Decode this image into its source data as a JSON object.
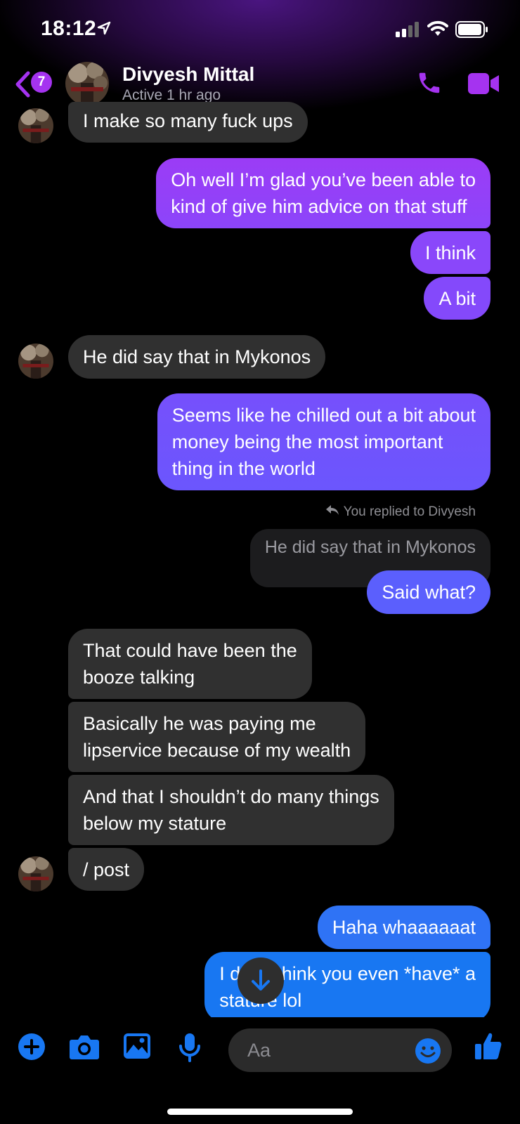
{
  "status_bar": {
    "time": "18:12",
    "location_icon": "location-arrow-icon",
    "signal_icon": "cellular-signal-icon",
    "wifi_icon": "wifi-icon",
    "battery_icon": "battery-icon"
  },
  "header": {
    "back_icon": "chevron-left-icon",
    "unread_count": "7",
    "contact_name": "Divyesh Mittal",
    "contact_status": "Active 1 hr ago",
    "call_icon": "phone-icon",
    "video_icon": "video-camera-icon"
  },
  "colors": {
    "accent": "#a533f0",
    "incoming_bubble": "#303030",
    "blue": "#1877f2"
  },
  "messages": [
    {
      "from": "them",
      "text": "I make so many fuck ups"
    },
    {
      "from": "me",
      "lines": [
        "Oh well I’m glad you’ve been able to",
        "kind of give him advice on that stuff"
      ]
    },
    {
      "from": "me",
      "text": "I think"
    },
    {
      "from": "me",
      "text": "A bit"
    },
    {
      "from": "them",
      "text": "He did say that in Mykonos"
    },
    {
      "from": "me",
      "lines": [
        "Seems like he chilled out a bit about",
        "money being the most important",
        "thing in the world"
      ]
    },
    {
      "from": "me",
      "reply_note": "You replied to Divyesh",
      "quoted": "He did say that in Mykonos",
      "text": "Said what?"
    },
    {
      "from": "them",
      "lines": [
        "That could have been the",
        "booze talking"
      ]
    },
    {
      "from": "them",
      "lines": [
        "Basically he was paying me",
        "lipservice because of my wealth"
      ]
    },
    {
      "from": "them",
      "lines": [
        "And that I shouldn’t do many things",
        "below my stature"
      ]
    },
    {
      "from": "them",
      "text": "/ post"
    },
    {
      "from": "me",
      "text": "Haha whaaaaaat"
    },
    {
      "from": "me",
      "lines": [
        "I don’t think you even *have* a",
        "stature lol"
      ]
    }
  ],
  "scroll_down_icon": "arrow-down-icon",
  "composer": {
    "placeholder": "Aa",
    "icons": [
      "plus-icon",
      "camera-icon",
      "photo-icon",
      "microphone-icon",
      "emoji-icon",
      "thumbs-up-icon"
    ]
  }
}
